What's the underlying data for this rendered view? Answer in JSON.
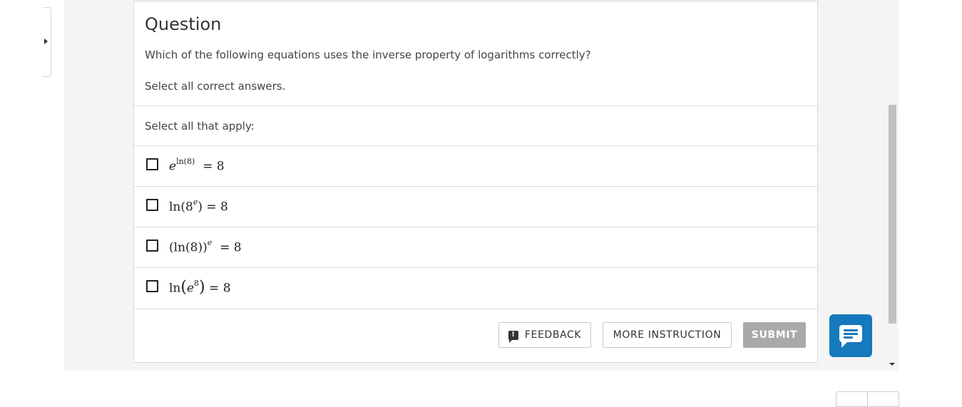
{
  "question": {
    "title": "Question",
    "prompt": "Which of the following equations uses the inverse property of logarithms correctly?",
    "instruction": "Select all correct answers."
  },
  "options_label": "Select all that apply:",
  "options": [
    {
      "base": "e",
      "exponent": "ln(8)",
      "equals": "= 8"
    },
    {
      "func": "ln(8",
      "exponent": "e",
      "close": ")",
      "equals": "= 8"
    },
    {
      "open": "(ln(8))",
      "exponent": "e",
      "equals": "= 8"
    },
    {
      "func": "ln",
      "base": "e",
      "exponent": "8",
      "equals": "= 8"
    }
  ],
  "buttons": {
    "feedback": "FEEDBACK",
    "feedback_icon_glyph": "!",
    "more_instruction": "MORE INSTRUCTION",
    "submit": "SUBMIT"
  },
  "colors": {
    "chat_button": "#1479bd",
    "submit_disabled": "#a9a9a9",
    "panel_background": "#f4f4f4"
  },
  "icons": {
    "feedback": "feedback-alert-icon",
    "chat": "chat-bubble-icon",
    "side_toggle": "triangle-right-icon",
    "scroll_down": "triangle-down-icon"
  }
}
